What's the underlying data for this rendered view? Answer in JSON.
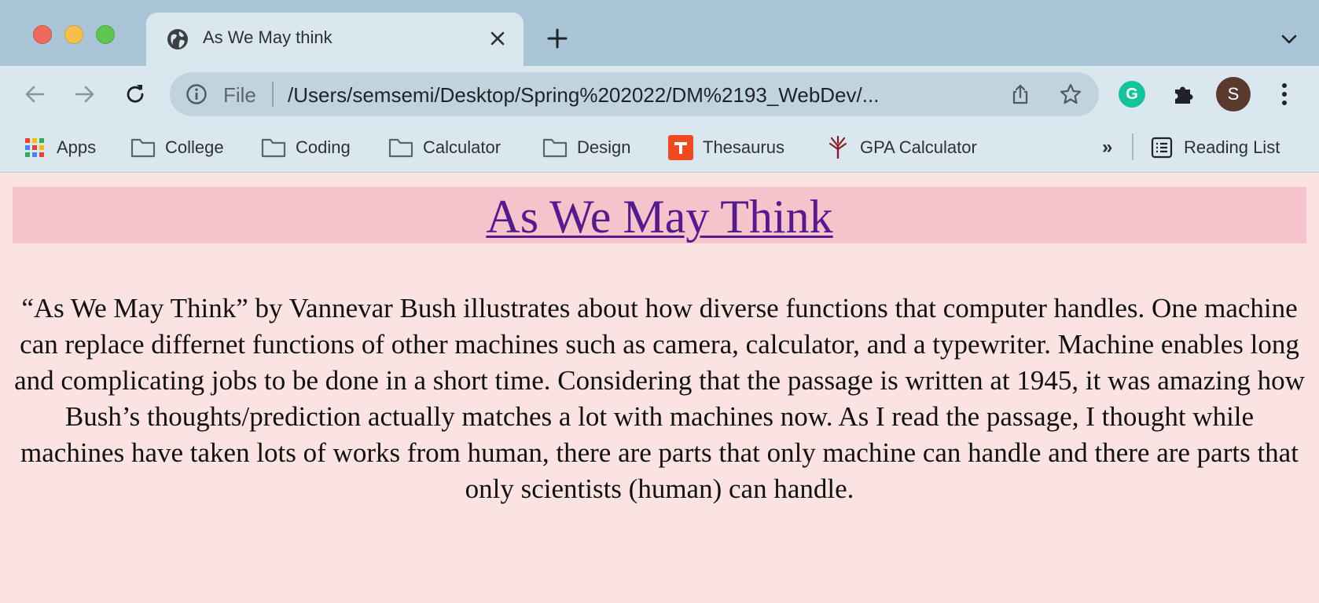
{
  "browser": {
    "tab_title": "As We May think",
    "address": {
      "scheme": "File",
      "url": "/Users/semsemi/Desktop/Spring%202022/DM%2193_WebDev/..."
    },
    "profile_initial": "S",
    "extension_initial": "G",
    "bookmarks": [
      {
        "label": "Apps",
        "icon": "apps-grid-icon"
      },
      {
        "label": "College",
        "icon": "folder-icon"
      },
      {
        "label": "Coding",
        "icon": "folder-icon"
      },
      {
        "label": "Calculator",
        "icon": "folder-icon"
      },
      {
        "label": "Design",
        "icon": "folder-icon"
      },
      {
        "label": "Thesaurus",
        "icon": "thesaurus-icon"
      },
      {
        "label": "GPA Calculator",
        "icon": "gpa-icon"
      }
    ],
    "overflow_label": "»",
    "reading_list_label": "Reading List",
    "colors": {
      "tabstrip": "#aac6d6",
      "toolbar": "#dbe7ee",
      "omnibox": "#c0d3df"
    }
  },
  "page": {
    "heading": "As We May Think",
    "body": "“As We May Think” by Vannevar Bush illustrates about how diverse functions that computer handles. One machine can replace differnet functions of other machines such as camera, calculator, and a typewriter. Machine enables long and complicating jobs to be done in a short time. Considering that the passage is written at 1945, it was amazing how Bush’s thoughts/prediction actually matches a lot with machines now. As I read the passage, I thought while machines have taken lots of works from human, there are parts that only machine can handle and there are parts that only scientists (human) can handle.",
    "colors": {
      "background": "#fbe3e1",
      "banner": "#f4c3cb",
      "link": "#551a8b"
    }
  }
}
